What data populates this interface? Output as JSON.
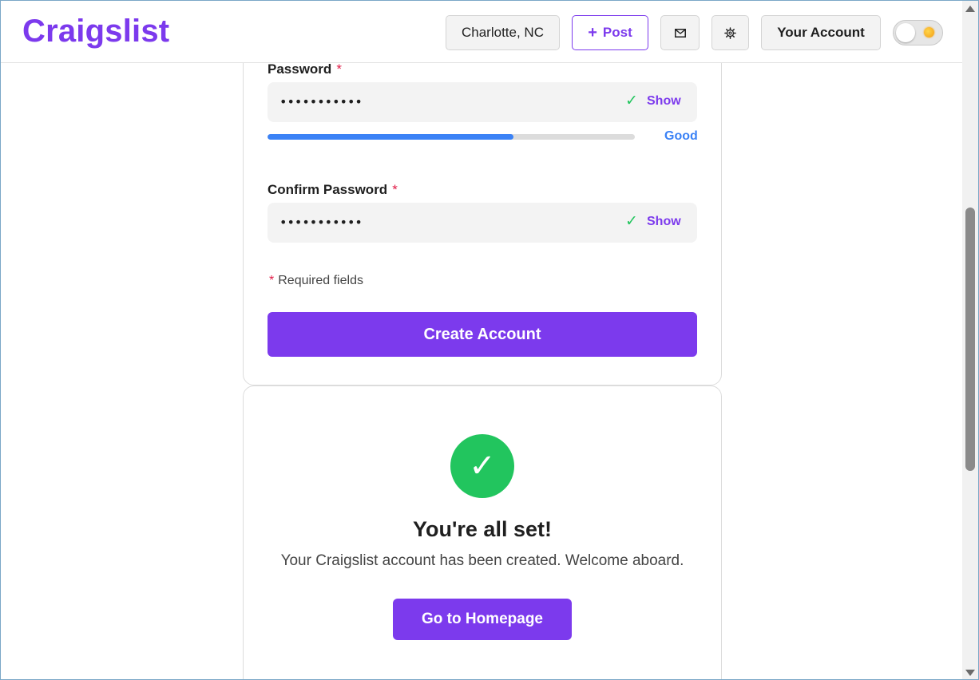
{
  "header": {
    "logo": "Craigslist",
    "location": "Charlotte, NC",
    "post_plus": "+",
    "post_label": "Post",
    "account_label": "Your Account",
    "mail_icon": "mail-icon",
    "gear_icon": "gear-icon",
    "theme_toggle": "light"
  },
  "form": {
    "password": {
      "label": "Password",
      "required_mark": "*",
      "value": "•••••••••••",
      "check": "✓",
      "show_label": "Show",
      "strength_label": "Good",
      "strength_fraction": 0.67,
      "strength_color": "#3b82f6"
    },
    "confirm": {
      "label": "Confirm Password",
      "required_mark": "*",
      "value": "•••••••••••",
      "check": "✓",
      "show_label": "Show"
    },
    "required_note_mark": "*",
    "required_note": "Required fields",
    "submit_label": "Create Account"
  },
  "success": {
    "check": "✓",
    "title": "You're all set!",
    "message": "Your Craigslist account has been created. Welcome aboard.",
    "button_label": "Go to Homepage"
  },
  "colors": {
    "accent": "#7c3aed",
    "success": "#22c55e",
    "required": "#e11d48"
  }
}
